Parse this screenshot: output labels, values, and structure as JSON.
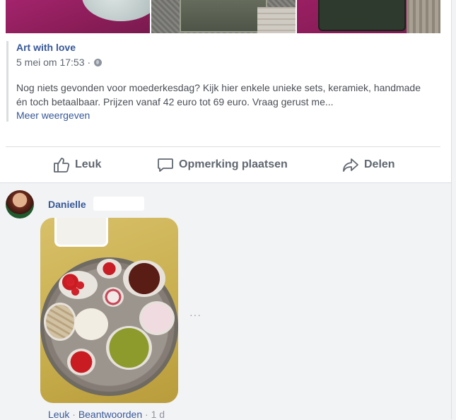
{
  "shared_post": {
    "page_name": "Art with love",
    "date": "5 mei om 17:53",
    "separator": "·",
    "privacy_icon": "globe-icon",
    "text": "Nog niets gevonden voor moederkesdag? Kijk hier enkele unieke sets, keramiek, handmade én toch betaalbaar. Prijzen vanaf 42 euro tot 69 euro. Vraag gerust me...",
    "see_more": "Meer weergeven"
  },
  "actions": {
    "like": {
      "label": "Leuk",
      "icon": "thumbs-up-icon"
    },
    "comment": {
      "label": "Opmerking plaatsen",
      "icon": "speech-bubble-icon"
    },
    "share": {
      "label": "Delen",
      "icon": "share-arrow-icon"
    }
  },
  "comment": {
    "author": "Danielle",
    "more_options": "···",
    "like_link": "Leuk",
    "reply_link": "Beantwoorden",
    "time": "1 d",
    "separator": "·"
  },
  "colors": {
    "link_blue": "#365899",
    "text_gray": "#606770",
    "background": "#f2f3f5"
  }
}
